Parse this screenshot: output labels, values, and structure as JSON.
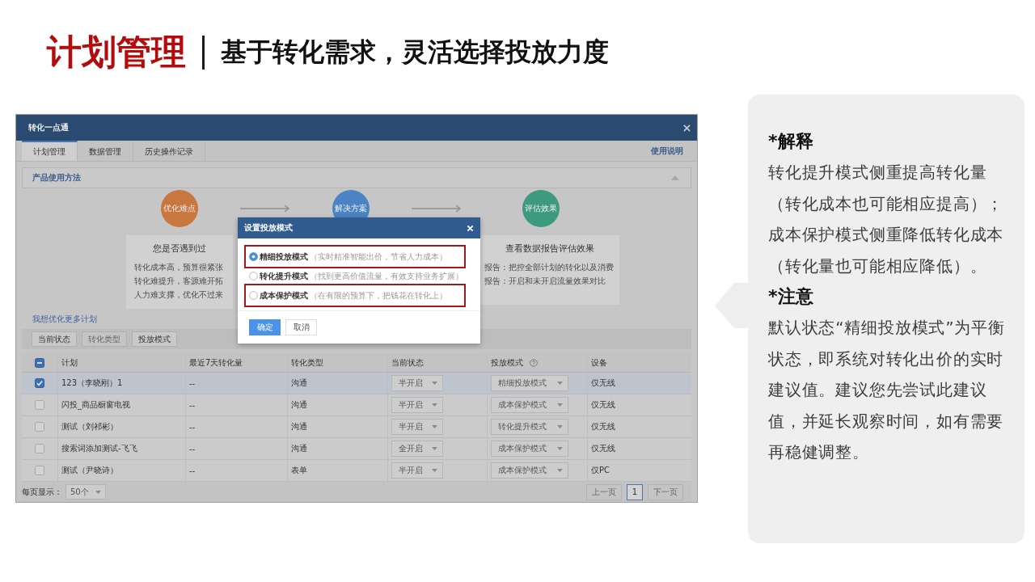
{
  "title": {
    "main": "计划管理",
    "subtitle": "基于转化需求，灵活选择投放力度"
  },
  "app": {
    "window_title": "转化一点通",
    "tabs": [
      {
        "label": "计划管理",
        "selected": true
      },
      {
        "label": "数据管理",
        "selected": false
      },
      {
        "label": "历史操作记录",
        "selected": false
      }
    ],
    "help_link": "使用说明",
    "guide": {
      "title": "产品使用方法",
      "expanded": true,
      "steps": [
        {
          "label": "优化难点",
          "color": "#c8773f",
          "card_title": "您是否遇到过",
          "card_lines": [
            "转化成本高，预算很紧张",
            "转化难提升，客源难开拓",
            "人力难支撑，优化不过来"
          ]
        },
        {
          "label": "解决方案",
          "color": "#4a84c4"
        },
        {
          "label": "评估效果",
          "color": "#3d9a7f",
          "card_title": "查看数据报告评估效果",
          "card_lines": [
            "报告：把控全部计划的转化以及消费",
            "报告：开启和未开启流量效果对比"
          ]
        }
      ]
    },
    "more_link": "我想优化更多计划",
    "toolbar": [
      {
        "label": "当前状态",
        "disabled": false
      },
      {
        "label": "转化类型",
        "disabled": true
      },
      {
        "label": "投放模式",
        "disabled": false
      }
    ],
    "table": {
      "select_all": {
        "indeterminate": true
      },
      "columns": [
        {
          "label": "计划",
          "kind": "plain"
        },
        {
          "label": "最近7天转化量",
          "kind": "plain"
        },
        {
          "label": "转化类型",
          "kind": "plain"
        },
        {
          "label": "当前状态",
          "kind": "plain"
        },
        {
          "label": "投放模式",
          "kind": "help"
        },
        {
          "label": "设备",
          "kind": "plain"
        }
      ],
      "rows": [
        {
          "checked": true,
          "plan": "123（李晓刚）1",
          "conversions": "--",
          "type": "沟通",
          "status": "半开启",
          "mode": "精细投放模式",
          "device": "仅无线"
        },
        {
          "checked": false,
          "plan": "闪投_商品橱窗电视",
          "conversions": "--",
          "type": "沟通",
          "status": "半开启",
          "mode": "成本保护模式",
          "device": "仅无线"
        },
        {
          "checked": false,
          "plan": "测试（刘祁彬）",
          "conversions": "--",
          "type": "沟通",
          "status": "半开启",
          "mode": "转化提升模式",
          "device": "仅无线"
        },
        {
          "checked": false,
          "plan": "搜索词添加测试-飞飞",
          "conversions": "--",
          "type": "沟通",
          "status": "全开启",
          "mode": "成本保护模式",
          "device": "仅无线"
        },
        {
          "checked": false,
          "plan": "测试（尹晓诗）",
          "conversions": "--",
          "type": "表单",
          "status": "半开启",
          "mode": "成本保护模式",
          "device": "仅PC"
        }
      ]
    },
    "page_size": {
      "label": "每页显示：",
      "value": "50个"
    },
    "pagination": {
      "prev": {
        "label": "上一页",
        "disabled": true
      },
      "pages": [
        {
          "label": "1",
          "selected": true
        }
      ],
      "next": {
        "label": "下一页",
        "disabled": true
      }
    }
  },
  "dialog": {
    "title": "设置投放模式",
    "options": [
      {
        "name": "精细投放模式",
        "description": "（实时精准智能出价，节省人力成本）",
        "selected": true,
        "highlighted": true
      },
      {
        "name": "转化提升模式",
        "description": "（找到更高价值流量，有效支持业务扩展）",
        "selected": false,
        "highlighted": false
      },
      {
        "name": "成本保护模式",
        "description": "（在有限的预算下，把钱花在转化上）",
        "selected": false,
        "highlighted": true
      }
    ],
    "buttons": [
      {
        "label": "确定",
        "kind": "primary"
      },
      {
        "label": "取消",
        "kind": "default"
      }
    ]
  },
  "notes": [
    {
      "heading": "*解释",
      "text": "转化提升模式侧重提高转化量（转化成本也可能相应提高）；成本保护模式侧重降低转化成本（转化量也可能相应降低）。"
    },
    {
      "heading": "*注意",
      "text": "默认状态“精细投放模式”为平衡状态，即系统对转化出价的实时建议值。建议您先尝试此建议值，并延长观察时间，如有需要再稳健调整。"
    }
  ]
}
